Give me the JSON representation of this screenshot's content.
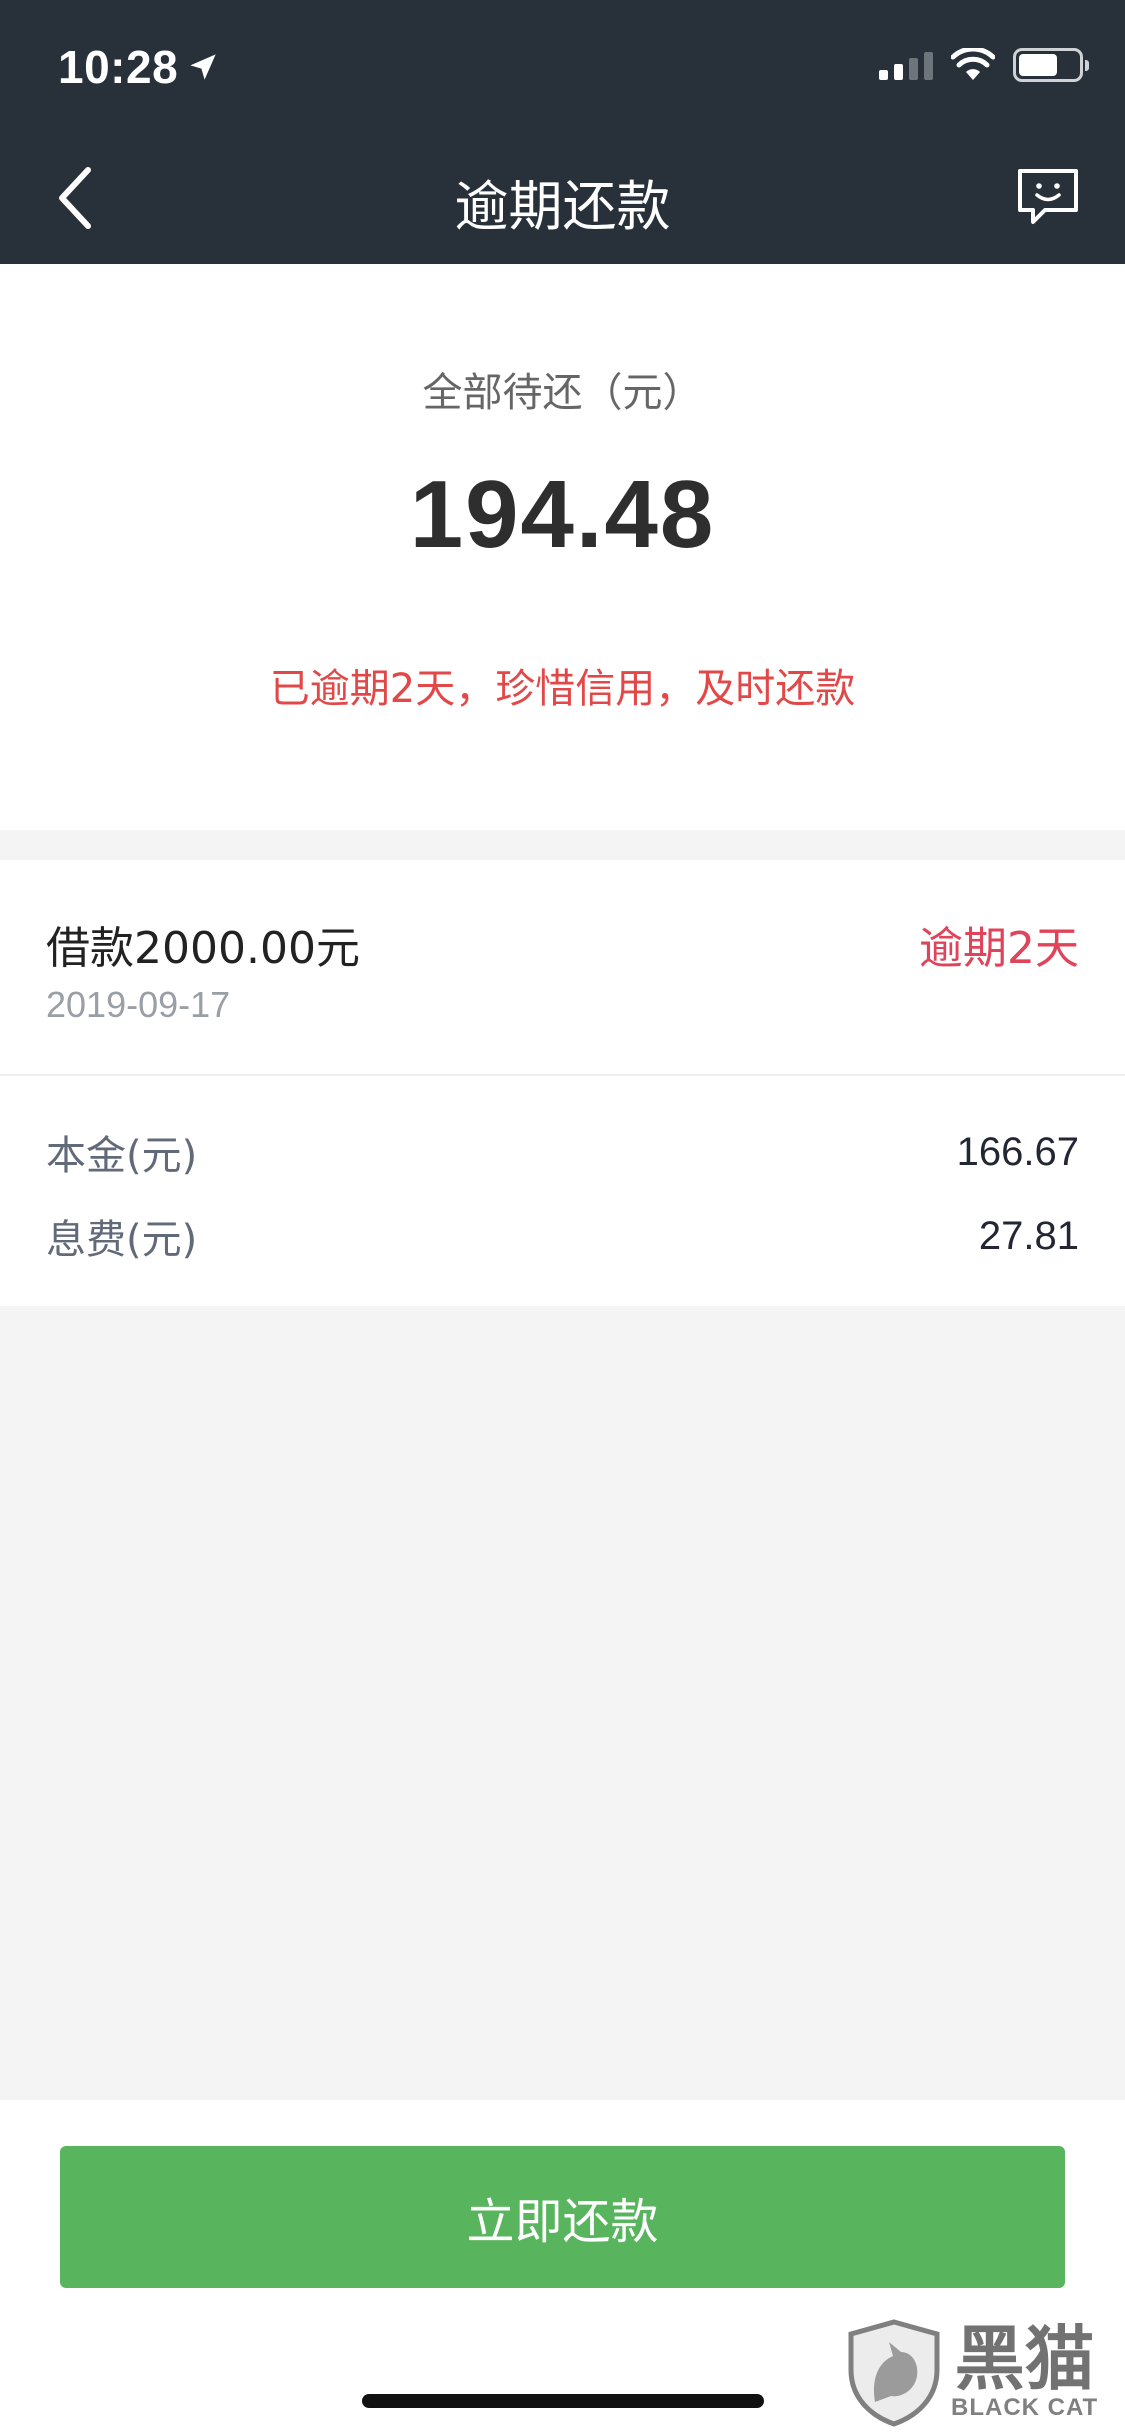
{
  "status_bar": {
    "time": "10:28",
    "icons": [
      "location-arrow-icon",
      "signal-icon",
      "wifi-icon",
      "battery-icon"
    ]
  },
  "nav": {
    "title": "逾期还款",
    "back_icon": "chevron-left-icon",
    "chat_icon": "chat-bubble-icon"
  },
  "summary": {
    "label": "全部待还（元）",
    "amount": "194.48",
    "warning": "已逾期2天，珍惜信用，及时还款"
  },
  "loan": {
    "title": "借款2000.00元",
    "date": "2019-09-17",
    "status": "逾期2天",
    "rows": [
      {
        "label": "本金(元)",
        "value": "166.67"
      },
      {
        "label": "息费(元)",
        "value": "27.81"
      }
    ]
  },
  "actions": {
    "pay_label": "立即还款"
  },
  "watermark": {
    "cn": "黑猫",
    "en": "BLACK CAT"
  },
  "colors": {
    "header_bg": "#283139",
    "accent_green": "#58b45d",
    "overdue_red": "#e0435a",
    "warning_red": "#e24848"
  }
}
